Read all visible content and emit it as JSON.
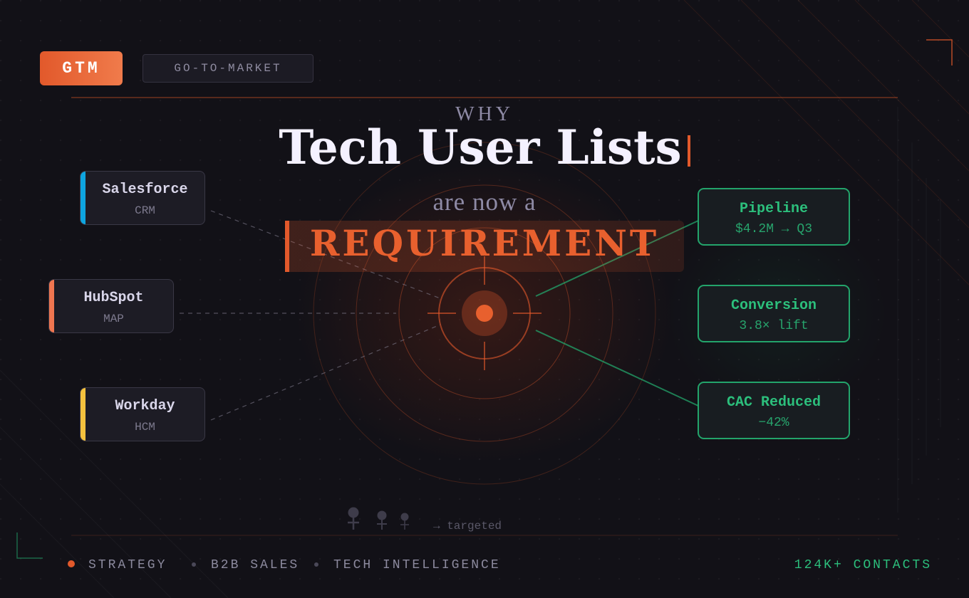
{
  "header": {
    "badge": "GTM",
    "tag": "GO-TO-MARKET"
  },
  "headline": {
    "eyebrow": "WHY",
    "title": "Tech User Lists",
    "subtitle": "are now a",
    "emphasis": "REQUIREMENT"
  },
  "sources": [
    {
      "name": "Salesforce",
      "type": "CRM",
      "color": "#0ea5e0"
    },
    {
      "name": "HubSpot",
      "type": "MAP",
      "color": "#f07650"
    },
    {
      "name": "Workday",
      "type": "HCM",
      "color": "#f5c23e"
    }
  ],
  "kpis": [
    {
      "label": "Pipeline",
      "value": "$4.2M → Q3"
    },
    {
      "label": "Conversion",
      "value": "3.8× lift"
    },
    {
      "label": "CAC Reduced",
      "value": "−42%"
    }
  ],
  "targeted_label": "→ targeted",
  "footer": {
    "tags": [
      "STRATEGY",
      "B2B SALES",
      "TECH INTELLIGENCE"
    ],
    "contacts": "124K+ CONTACTS"
  },
  "colors": {
    "accent": "#e2592b",
    "success": "#2cbf7c",
    "background": "#121117"
  }
}
